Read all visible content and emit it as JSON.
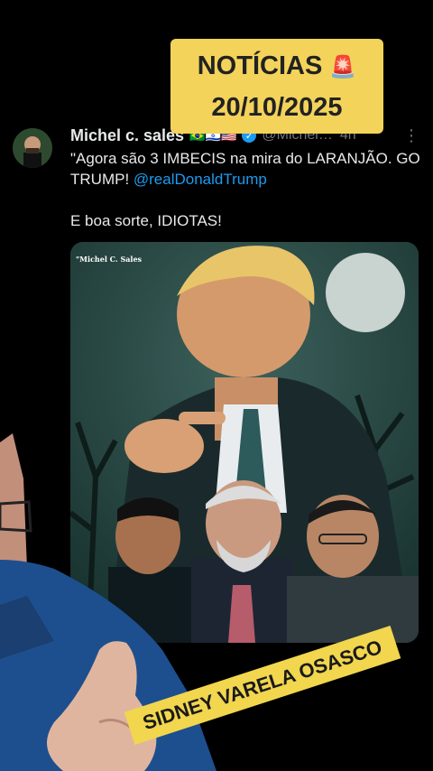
{
  "banner": {
    "title": "NOTÍCIAS",
    "siren_icon": "🚨",
    "date": "20/10/2025"
  },
  "post": {
    "author": {
      "name": "Michel c. sales",
      "flags": "🇧🇷🇮🇱🇺🇸",
      "handle": "@Michel…",
      "time": "4h"
    },
    "more_icon": "⋮",
    "text_line1": "\"Agora são 3 IMBECIS na mira do LARANJÃO. GO TRUMP! ",
    "mention": "@realDonaldTrump",
    "text_line2": "E boa sorte, IDIOTAS!",
    "image": {
      "watermark": "\"Michel C. Sales"
    }
  },
  "sticker": {
    "text": "SIDNEY VARELA OSASCO"
  },
  "colors": {
    "background": "#000000",
    "text": "#e7e9ea",
    "muted": "#71767b",
    "link": "#1d9bf0",
    "banner": "#f3d35a"
  }
}
